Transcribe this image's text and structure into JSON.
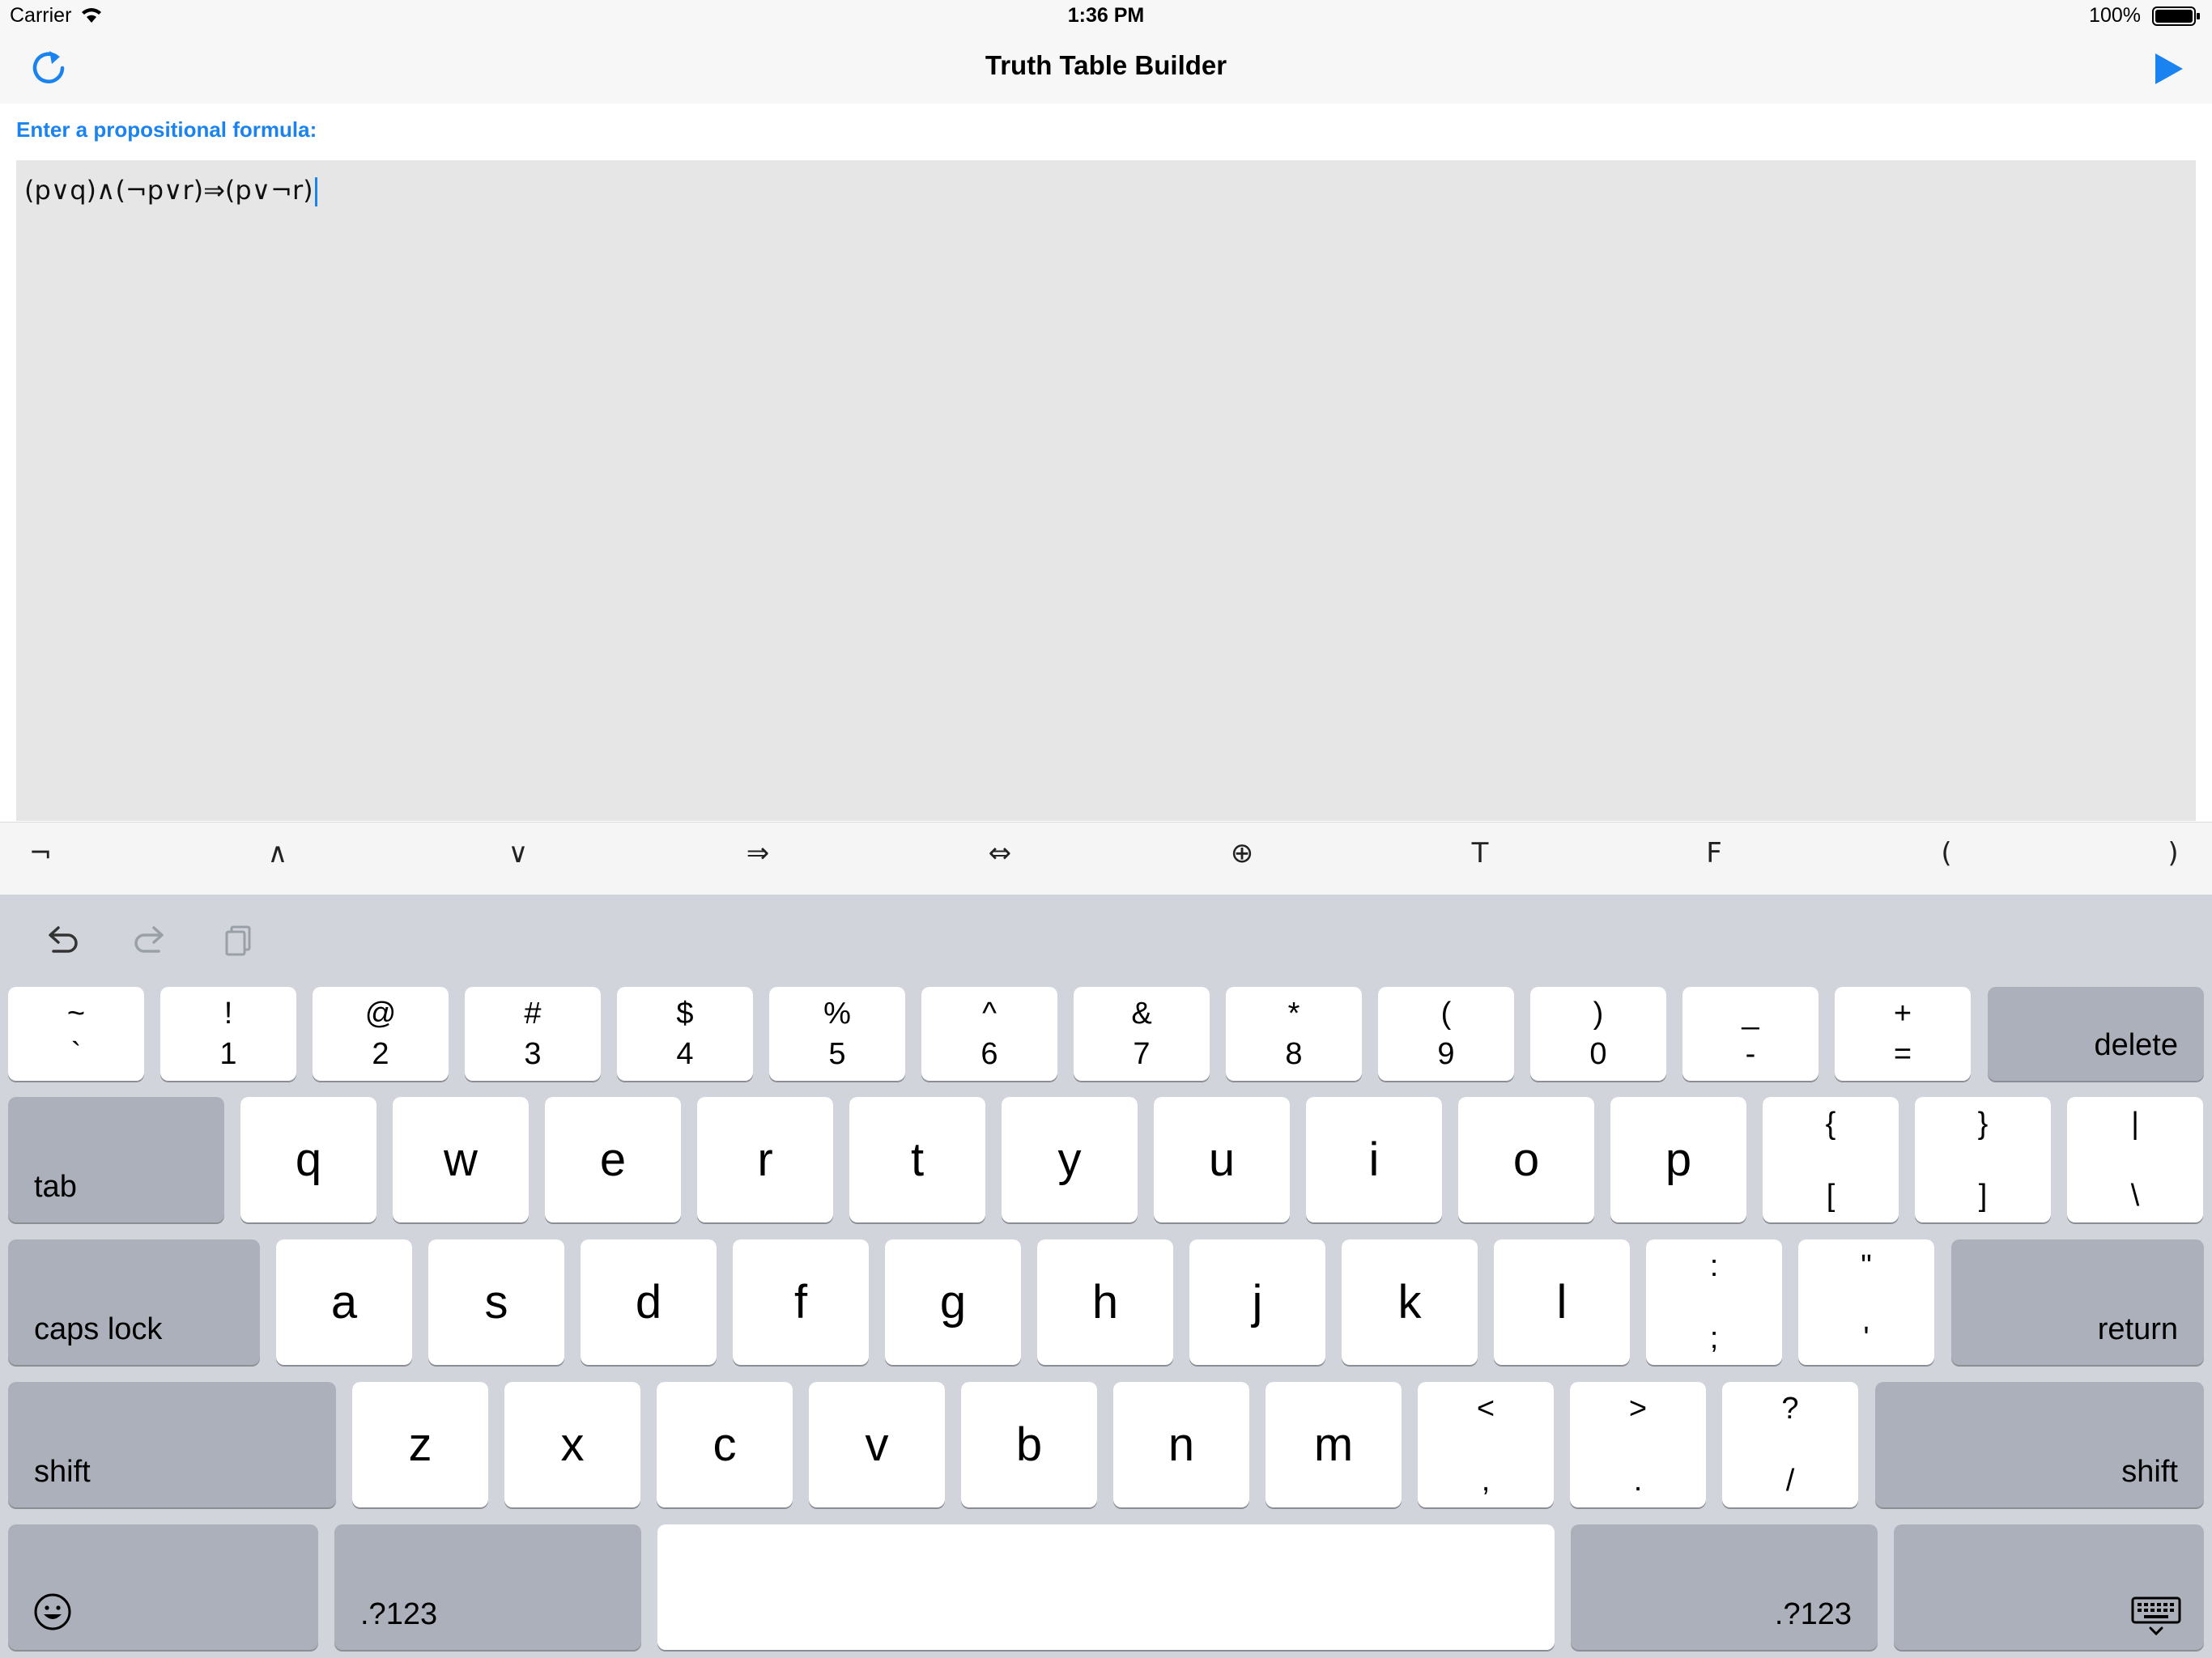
{
  "status": {
    "carrier": "Carrier",
    "time": "1:36 PM",
    "battery": "100%"
  },
  "nav": {
    "title": "Truth Table Builder"
  },
  "prompt": "Enter a propositional formula:",
  "formula": "(p∨q)∧(¬p∨r)⇒(p∨¬r)",
  "symbols": [
    "¬",
    "∧",
    "∨",
    "⇒",
    "⇔",
    "⊕",
    "T",
    "F",
    "(",
    ")"
  ],
  "keyboard": {
    "row1": [
      {
        "top": "~",
        "bot": "`"
      },
      {
        "top": "!",
        "bot": "1"
      },
      {
        "top": "@",
        "bot": "2"
      },
      {
        "top": "#",
        "bot": "3"
      },
      {
        "top": "$",
        "bot": "4"
      },
      {
        "top": "%",
        "bot": "5"
      },
      {
        "top": "^",
        "bot": "6"
      },
      {
        "top": "&",
        "bot": "7"
      },
      {
        "top": "*",
        "bot": "8"
      },
      {
        "top": "(",
        "bot": "9"
      },
      {
        "top": ")",
        "bot": "0"
      },
      {
        "top": "_",
        "bot": "-"
      },
      {
        "top": "+",
        "bot": "="
      }
    ],
    "delete": "delete",
    "tab": "tab",
    "row2": [
      "q",
      "w",
      "e",
      "r",
      "t",
      "y",
      "u",
      "i",
      "o",
      "p"
    ],
    "row2_sym": [
      {
        "top": "{",
        "bot": "["
      },
      {
        "top": "}",
        "bot": "]"
      },
      {
        "top": "|",
        "bot": "\\"
      }
    ],
    "caps_lock": "caps lock",
    "row3": [
      "a",
      "s",
      "d",
      "f",
      "g",
      "h",
      "j",
      "k",
      "l"
    ],
    "row3_sym": [
      {
        "top": ":",
        "bot": ";"
      },
      {
        "top": "\"",
        "bot": "'"
      }
    ],
    "return": "return",
    "shift": "shift",
    "row4": [
      "z",
      "x",
      "c",
      "v",
      "b",
      "n",
      "m"
    ],
    "row4_sym": [
      {
        "top": "<",
        "bot": ","
      },
      {
        "top": ">",
        "bot": "."
      },
      {
        "top": "?",
        "bot": "/"
      }
    ],
    "numbers_label": ".?123"
  }
}
